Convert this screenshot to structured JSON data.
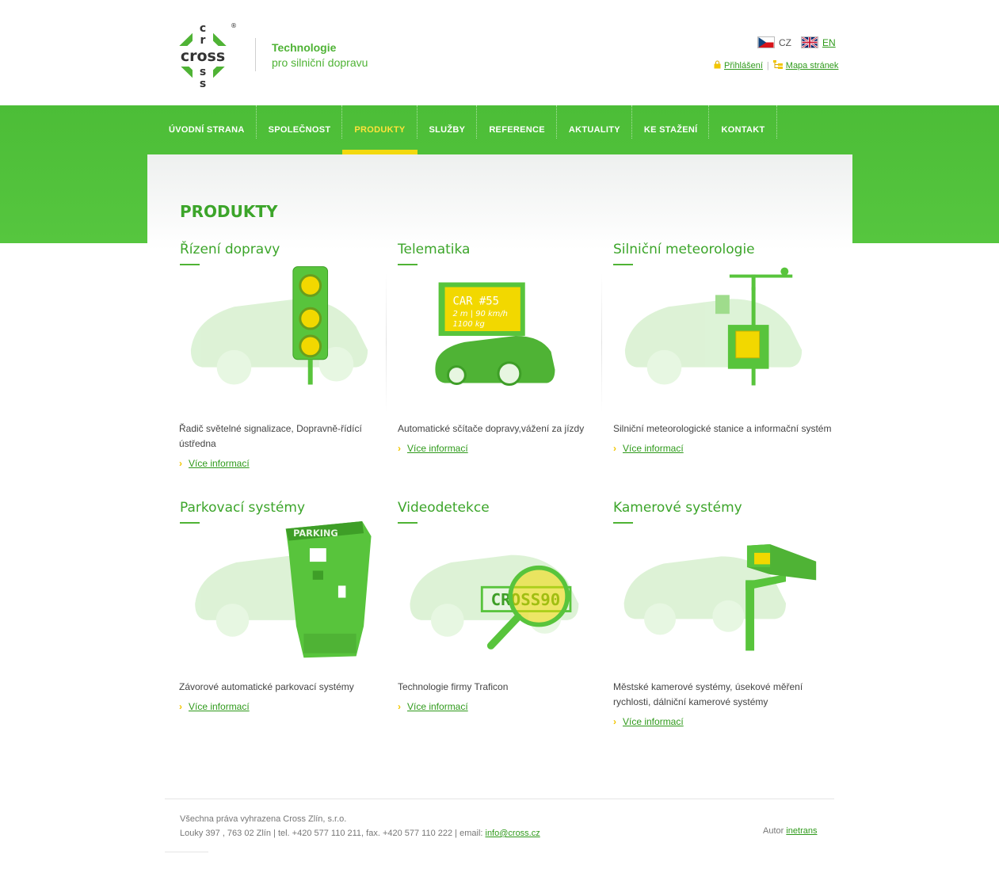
{
  "brand": {
    "logo_text": "cross",
    "registered_mark": "®",
    "tagline_line1": "Technologie",
    "tagline_line2": "pro silniční dopravu"
  },
  "languages": [
    {
      "code": "CZ",
      "active": true
    },
    {
      "code": "EN",
      "active": false
    }
  ],
  "utility_links": {
    "login": "Přihlášení",
    "separator": "|",
    "sitemap": "Mapa stránek"
  },
  "nav": {
    "items": [
      {
        "label": "Úvodní strana",
        "active": false
      },
      {
        "label": "Společnost",
        "active": false
      },
      {
        "label": "Produkty",
        "active": true
      },
      {
        "label": "Služby",
        "active": false
      },
      {
        "label": "Reference",
        "active": false
      },
      {
        "label": "Aktuality",
        "active": false
      },
      {
        "label": "Ke stažení",
        "active": false
      },
      {
        "label": "Kontakt",
        "active": false
      }
    ]
  },
  "page": {
    "title": "PRODUKTY"
  },
  "products": [
    {
      "title": "Řízení dopravy",
      "description": "Řadič světelné signalizace, Dopravně-řídící ústředna",
      "more": "Více informací",
      "icon": "traffic-light-icon"
    },
    {
      "title": "Telematika",
      "description": "Automatické sčítače dopravy,vážení za jízdy",
      "more": "Více informací",
      "icon": "telematics-sign-icon",
      "sign_line1": "CAR #55",
      "sign_line2": "2 m | 90 km/h",
      "sign_line3": "1100 kg"
    },
    {
      "title": "Silniční meteorologie",
      "description": "Silniční meteorologické stanice a informační systém",
      "more": "Více informací",
      "icon": "weather-station-icon"
    },
    {
      "title": "Parkovací systémy",
      "description": "Závorové automatické parkovací systémy",
      "more": "Více informací",
      "icon": "parking-machine-icon",
      "machine_label": "PARKING"
    },
    {
      "title": "Videodetekce",
      "description": "Technologie firmy Traficon",
      "more": "Více informací",
      "icon": "magnifier-plate-icon",
      "plate_text": "CROSS90"
    },
    {
      "title": "Kamerové systémy",
      "description": "Městské kamerové systémy, úsekové měření rychlosti, dálniční kamerové systémy",
      "more": "Více informací",
      "icon": "camera-icon"
    }
  ],
  "footer": {
    "rights": "Všechna práva vyhrazena Cross Zlín, s.r.o.",
    "address": "Louky 397 , 763 02 Zlín | tel. +420 577 110 211, fax. +420 577 110 222 | email: ",
    "email": "info@cross.cz",
    "author_label": "Autor ",
    "author_link": "inetrans"
  },
  "colors": {
    "brand_green": "#4cbd37",
    "active_yellow": "#ffe23a",
    "title_green": "#3ca52a"
  }
}
